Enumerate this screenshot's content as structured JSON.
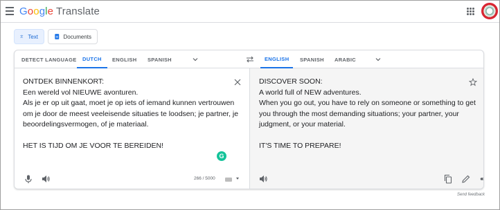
{
  "header": {
    "logo_letters": [
      "G",
      "o",
      "o",
      "g",
      "l",
      "e"
    ],
    "product": "Translate"
  },
  "modes": [
    {
      "label": "Text",
      "active": true
    },
    {
      "label": "Documents",
      "active": false
    }
  ],
  "source_langs": [
    {
      "label": "DETECT LANGUAGE",
      "active": false
    },
    {
      "label": "DUTCH",
      "active": true
    },
    {
      "label": "ENGLISH",
      "active": false
    },
    {
      "label": "SPANISH",
      "active": false
    }
  ],
  "target_langs": [
    {
      "label": "ENGLISH",
      "active": true
    },
    {
      "label": "SPANISH",
      "active": false
    },
    {
      "label": "ARABIC",
      "active": false
    }
  ],
  "source_text": [
    "ONTDEK BINNENKORT:",
    "Een wereld vol NIEUWE avonturen.",
    "Als je er op uit gaat, moet je op iets of iemand kunnen vertrouwen",
    "om je door de meest veeleisende situaties te loodsen; je partner, je",
    "beoordelingsvermogen, of je materiaal.",
    "",
    "HET IS TIJD OM JE VOOR TE BEREIDEN!"
  ],
  "target_text": [
    "DISCOVER SOON:",
    "A world full of NEW adventures.",
    "When you go out, you have to rely on someone or something to get",
    "you through the most demanding situations; your partner, your",
    "judgment, or your material.",
    "",
    "IT'S TIME TO PREPARE!"
  ],
  "char_count": "266 / 5000",
  "grammarly_letter": "G",
  "feedback": "Send feedback",
  "icons": [
    "menu-icon",
    "apps-icon",
    "translate-icon",
    "document-icon",
    "swap-icon",
    "close-icon",
    "star-icon",
    "mic-icon",
    "speaker-icon",
    "copy-icon",
    "edit-icon",
    "share-icon",
    "keyboard-icon"
  ],
  "colors": {
    "accent": "#1a73e8",
    "active_bg": "#e8f0fe",
    "target_bg": "#f5f5f5"
  }
}
